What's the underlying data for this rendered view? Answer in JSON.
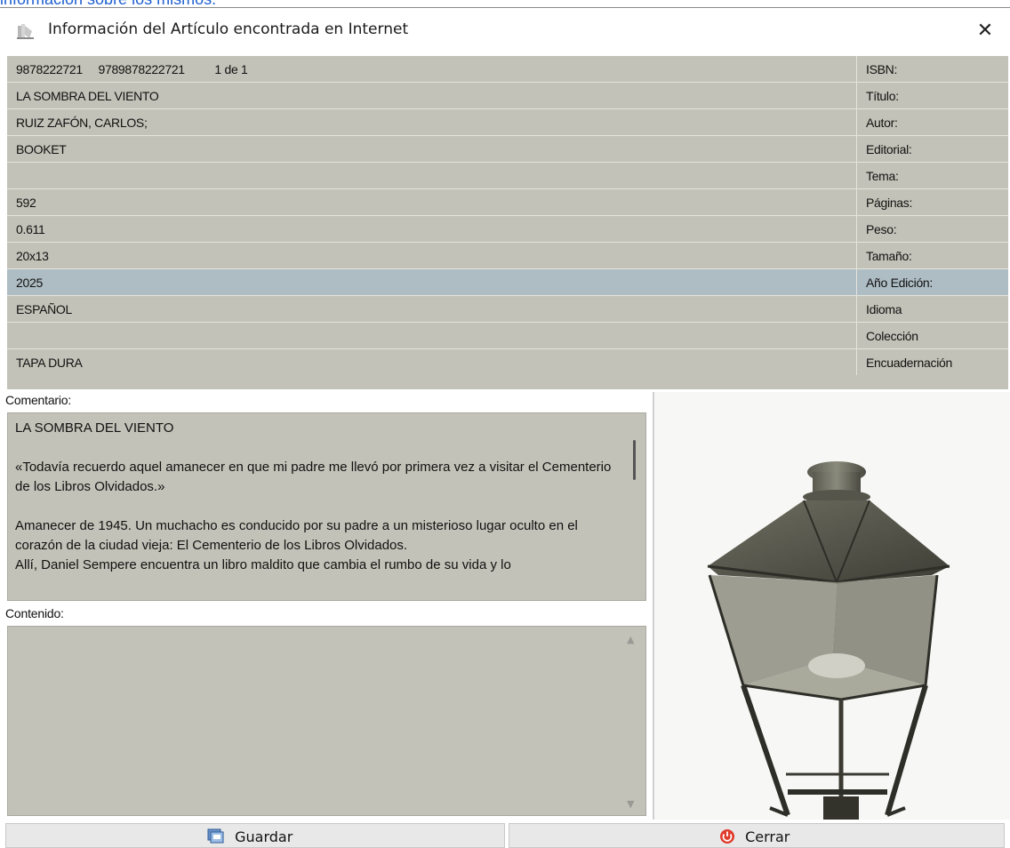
{
  "background_text": "información sobre los mismos.",
  "window": {
    "title": "Información del Artículo encontrada en Internet",
    "close_glyph": "✕"
  },
  "isbn": {
    "isbn10": "9878222721",
    "isbn13": "9789878222721",
    "counter": "1 de 1"
  },
  "fields": [
    {
      "value": "",
      "label": "ISBN:"
    },
    {
      "value": "LA SOMBRA DEL VIENTO",
      "label": "Título:"
    },
    {
      "value": "RUIZ ZAFÓN, CARLOS;",
      "label": "Autor:"
    },
    {
      "value": "BOOKET",
      "label": "Editorial:"
    },
    {
      "value": "",
      "label": "Tema:"
    },
    {
      "value": "592",
      "label": "Páginas:"
    },
    {
      "value": "0.611",
      "label": "Peso:"
    },
    {
      "value": "20x13",
      "label": "Tamaño:"
    },
    {
      "value": "2025",
      "label": "Año Edición:"
    },
    {
      "value": "ESPAÑOL",
      "label": "Idioma"
    },
    {
      "value": "",
      "label": "Colección"
    },
    {
      "value": "TAPA DURA",
      "label": "Encuadernación"
    }
  ],
  "comentario": {
    "label": "Comentario:",
    "paragraphs": [
      "LA SOMBRA DEL VIENTO",
      "«Todavía recuerdo aquel amanecer en que mi padre me llevó por primera vez a visitar el Cementerio de los Libros Olvidados.»",
      "Amanecer de 1945. Un muchacho es conducido por su padre a un misterioso lugar oculto en el corazón de la ciudad vieja: El Cementerio de los Libros Olvidados.",
      "Allí, Daniel Sempere encuentra un libro maldito que cambia el rumbo de su vida y lo"
    ]
  },
  "contenido": {
    "label": "Contenido:",
    "text": ""
  },
  "buttons": {
    "save": "Guardar",
    "close": "Cerrar"
  },
  "icons": {
    "title": "book-icon",
    "save": "save-icon",
    "close": "power-icon"
  }
}
